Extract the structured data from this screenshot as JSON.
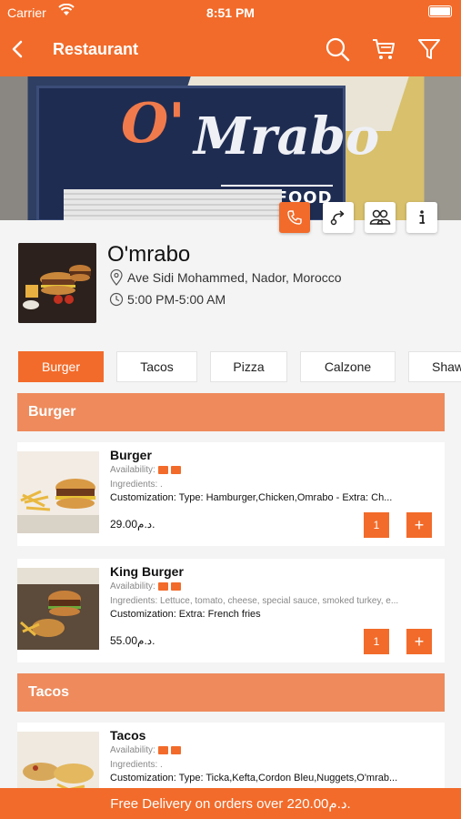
{
  "status_bar": {
    "carrier": "Carrier",
    "time": "8:51 PM"
  },
  "header": {
    "title": "Restaurant",
    "icons": [
      "back-icon",
      "search-icon",
      "cart-icon",
      "filter-icon"
    ]
  },
  "hero": {
    "sign_o": "O'",
    "sign_main": "Mrabo",
    "sign_sub": "FAST FOOD",
    "actions": [
      "phone-icon",
      "directions-icon",
      "group-icon",
      "info-icon"
    ]
  },
  "restaurant": {
    "name": "O'mrabo",
    "address": "Ave Sidi Mohammed, Nador, Morocco",
    "hours": "5:00 PM-5:00 AM"
  },
  "tabs": [
    {
      "label": "Burger",
      "active": true
    },
    {
      "label": "Tacos",
      "active": false
    },
    {
      "label": "Pizza",
      "active": false
    },
    {
      "label": "Calzone",
      "active": false
    },
    {
      "label": "Shaw",
      "active": false
    }
  ],
  "sections": [
    {
      "title": "Burger",
      "items": [
        {
          "name": "Burger",
          "availability": "Availability:",
          "ingredients": "Ingredients: .",
          "customization": "Customization: Type: Hamburger,Chicken,Omrabo  - Extra: Ch...",
          "price": "29.00د.م.",
          "quantity": "1",
          "add": "+"
        },
        {
          "name": "King Burger",
          "availability": "Availability:",
          "ingredients": "Ingredients: Lettuce, tomato, cheese, special sauce, smoked turkey, e...",
          "customization": "Customization: Extra: French fries",
          "price": "55.00د.م.",
          "quantity": "1",
          "add": "+"
        }
      ]
    },
    {
      "title": "Tacos",
      "items": [
        {
          "name": "Tacos",
          "availability": "Availability:",
          "ingredients": "Ingredients: .",
          "customization": "Customization: Type: Ticka,Kefta,Cordon Bleu,Nuggets,O'mrab..."
        }
      ]
    }
  ],
  "footer": {
    "text": "Free Delivery on orders over 220.00د.م."
  },
  "colors": {
    "brand": "#f26b2a",
    "section_header": "#ee8a5c",
    "background": "#f4f4f4"
  }
}
